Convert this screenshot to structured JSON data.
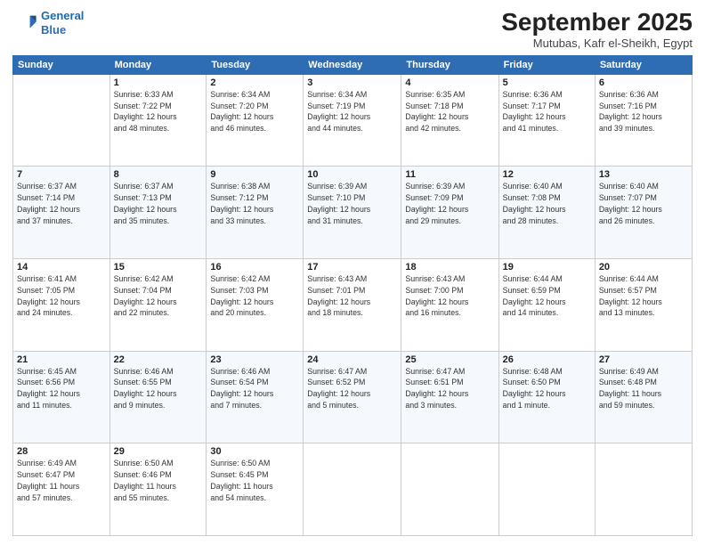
{
  "logo": {
    "line1": "General",
    "line2": "Blue"
  },
  "title": "September 2025",
  "subtitle": "Mutubas, Kafr el-Sheikh, Egypt",
  "header_days": [
    "Sunday",
    "Monday",
    "Tuesday",
    "Wednesday",
    "Thursday",
    "Friday",
    "Saturday"
  ],
  "weeks": [
    [
      {
        "day": "",
        "info": ""
      },
      {
        "day": "1",
        "info": "Sunrise: 6:33 AM\nSunset: 7:22 PM\nDaylight: 12 hours\nand 48 minutes."
      },
      {
        "day": "2",
        "info": "Sunrise: 6:34 AM\nSunset: 7:20 PM\nDaylight: 12 hours\nand 46 minutes."
      },
      {
        "day": "3",
        "info": "Sunrise: 6:34 AM\nSunset: 7:19 PM\nDaylight: 12 hours\nand 44 minutes."
      },
      {
        "day": "4",
        "info": "Sunrise: 6:35 AM\nSunset: 7:18 PM\nDaylight: 12 hours\nand 42 minutes."
      },
      {
        "day": "5",
        "info": "Sunrise: 6:36 AM\nSunset: 7:17 PM\nDaylight: 12 hours\nand 41 minutes."
      },
      {
        "day": "6",
        "info": "Sunrise: 6:36 AM\nSunset: 7:16 PM\nDaylight: 12 hours\nand 39 minutes."
      }
    ],
    [
      {
        "day": "7",
        "info": "Sunrise: 6:37 AM\nSunset: 7:14 PM\nDaylight: 12 hours\nand 37 minutes."
      },
      {
        "day": "8",
        "info": "Sunrise: 6:37 AM\nSunset: 7:13 PM\nDaylight: 12 hours\nand 35 minutes."
      },
      {
        "day": "9",
        "info": "Sunrise: 6:38 AM\nSunset: 7:12 PM\nDaylight: 12 hours\nand 33 minutes."
      },
      {
        "day": "10",
        "info": "Sunrise: 6:39 AM\nSunset: 7:10 PM\nDaylight: 12 hours\nand 31 minutes."
      },
      {
        "day": "11",
        "info": "Sunrise: 6:39 AM\nSunset: 7:09 PM\nDaylight: 12 hours\nand 29 minutes."
      },
      {
        "day": "12",
        "info": "Sunrise: 6:40 AM\nSunset: 7:08 PM\nDaylight: 12 hours\nand 28 minutes."
      },
      {
        "day": "13",
        "info": "Sunrise: 6:40 AM\nSunset: 7:07 PM\nDaylight: 12 hours\nand 26 minutes."
      }
    ],
    [
      {
        "day": "14",
        "info": "Sunrise: 6:41 AM\nSunset: 7:05 PM\nDaylight: 12 hours\nand 24 minutes."
      },
      {
        "day": "15",
        "info": "Sunrise: 6:42 AM\nSunset: 7:04 PM\nDaylight: 12 hours\nand 22 minutes."
      },
      {
        "day": "16",
        "info": "Sunrise: 6:42 AM\nSunset: 7:03 PM\nDaylight: 12 hours\nand 20 minutes."
      },
      {
        "day": "17",
        "info": "Sunrise: 6:43 AM\nSunset: 7:01 PM\nDaylight: 12 hours\nand 18 minutes."
      },
      {
        "day": "18",
        "info": "Sunrise: 6:43 AM\nSunset: 7:00 PM\nDaylight: 12 hours\nand 16 minutes."
      },
      {
        "day": "19",
        "info": "Sunrise: 6:44 AM\nSunset: 6:59 PM\nDaylight: 12 hours\nand 14 minutes."
      },
      {
        "day": "20",
        "info": "Sunrise: 6:44 AM\nSunset: 6:57 PM\nDaylight: 12 hours\nand 13 minutes."
      }
    ],
    [
      {
        "day": "21",
        "info": "Sunrise: 6:45 AM\nSunset: 6:56 PM\nDaylight: 12 hours\nand 11 minutes."
      },
      {
        "day": "22",
        "info": "Sunrise: 6:46 AM\nSunset: 6:55 PM\nDaylight: 12 hours\nand 9 minutes."
      },
      {
        "day": "23",
        "info": "Sunrise: 6:46 AM\nSunset: 6:54 PM\nDaylight: 12 hours\nand 7 minutes."
      },
      {
        "day": "24",
        "info": "Sunrise: 6:47 AM\nSunset: 6:52 PM\nDaylight: 12 hours\nand 5 minutes."
      },
      {
        "day": "25",
        "info": "Sunrise: 6:47 AM\nSunset: 6:51 PM\nDaylight: 12 hours\nand 3 minutes."
      },
      {
        "day": "26",
        "info": "Sunrise: 6:48 AM\nSunset: 6:50 PM\nDaylight: 12 hours\nand 1 minute."
      },
      {
        "day": "27",
        "info": "Sunrise: 6:49 AM\nSunset: 6:48 PM\nDaylight: 11 hours\nand 59 minutes."
      }
    ],
    [
      {
        "day": "28",
        "info": "Sunrise: 6:49 AM\nSunset: 6:47 PM\nDaylight: 11 hours\nand 57 minutes."
      },
      {
        "day": "29",
        "info": "Sunrise: 6:50 AM\nSunset: 6:46 PM\nDaylight: 11 hours\nand 55 minutes."
      },
      {
        "day": "30",
        "info": "Sunrise: 6:50 AM\nSunset: 6:45 PM\nDaylight: 11 hours\nand 54 minutes."
      },
      {
        "day": "",
        "info": ""
      },
      {
        "day": "",
        "info": ""
      },
      {
        "day": "",
        "info": ""
      },
      {
        "day": "",
        "info": ""
      }
    ]
  ]
}
